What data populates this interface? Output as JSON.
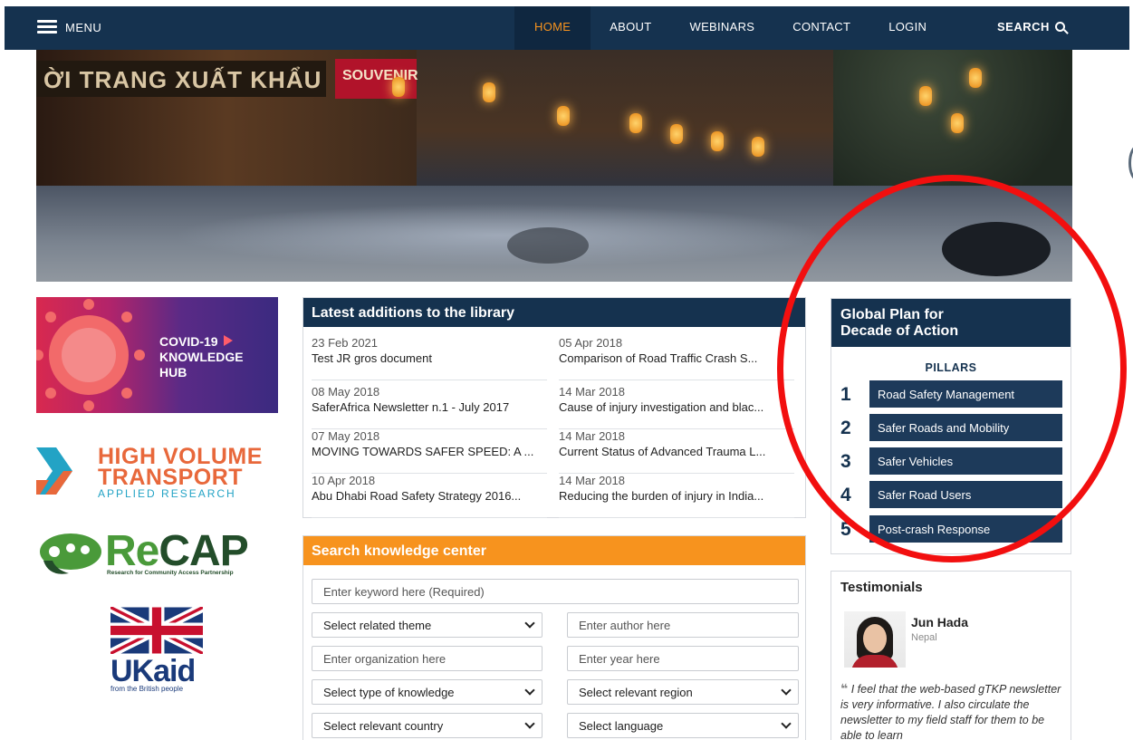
{
  "nav": {
    "menu_label": "MENU",
    "links": [
      "HOME",
      "ABOUT",
      "WEBINARS",
      "CONTACT",
      "LOGIN"
    ],
    "search_label": "SEARCH"
  },
  "hero": {
    "sign_text": "ỜI TRANG XUẤT KHẨU",
    "souvenir_text": "SOUVENIR"
  },
  "partners": {
    "covid": {
      "line1": "COVID-19",
      "line2": "KNOWLEDGE",
      "line3": "HUB"
    },
    "hvt": {
      "line1": "HIGH VOLUME",
      "line2": "TRANSPORT",
      "line3": "APPLIED RESEARCH"
    },
    "recap": {
      "re": "Re",
      "cap": "CAP",
      "sub": "Research for Community Access Partnership"
    },
    "ukaid": {
      "name": "UKaid",
      "sub": "from the British people"
    }
  },
  "library": {
    "title": "Latest additions to the library",
    "items": [
      {
        "date": "23 Feb 2021",
        "title": "Test JR gros document"
      },
      {
        "date": "05 Apr 2018",
        "title": "Comparison of Road Traffic Crash S..."
      },
      {
        "date": "08 May 2018",
        "title": "SaferAfrica Newsletter n.1 - July 2017"
      },
      {
        "date": "14 Mar 2018",
        "title": "Cause of injury investigation and blac..."
      },
      {
        "date": "07 May 2018",
        "title": "MOVING TOWARDS SAFER SPEED: A ..."
      },
      {
        "date": "14 Mar 2018",
        "title": "Current Status of Advanced Trauma L..."
      },
      {
        "date": "10 Apr 2018",
        "title": "Abu Dhabi Road Safety Strategy 2016..."
      },
      {
        "date": "14 Mar 2018",
        "title": "Reducing the burden of injury in India..."
      }
    ]
  },
  "search": {
    "title": "Search knowledge center",
    "keyword_placeholder": "Enter keyword here (Required)",
    "theme": "Select related theme",
    "author_placeholder": "Enter author here",
    "organization_placeholder": "Enter organization here",
    "year_placeholder": "Enter year here",
    "knowledge_type": "Select type of knowledge",
    "region": "Select relevant region",
    "country": "Select relevant country",
    "language": "Select language"
  },
  "plan": {
    "title_line1": "Global Plan for",
    "title_line2": "Decade of Action",
    "pillars_label": "PILLARS",
    "pillars": [
      {
        "num": "1",
        "label": "Road Safety Management"
      },
      {
        "num": "2",
        "label": "Safer Roads and Mobility"
      },
      {
        "num": "3",
        "label": "Safer Vehicles"
      },
      {
        "num": "4",
        "label": "Safer Road Users"
      },
      {
        "num": "5",
        "label": "Post-crash Response"
      }
    ]
  },
  "testimonials": {
    "title": "Testimonials",
    "name": "Jun Hada",
    "place": "Nepal",
    "quote_mark": "❝",
    "quote": "I feel that the web-based gTKP newsletter is very informative. I also circulate the newsletter to my field staff for them to be able to learn"
  },
  "colors": {
    "navy": "#15324f",
    "accent_orange": "#f7931e",
    "pillar_button": "#1d3a5a",
    "annotation_red": "#f20f0f"
  }
}
